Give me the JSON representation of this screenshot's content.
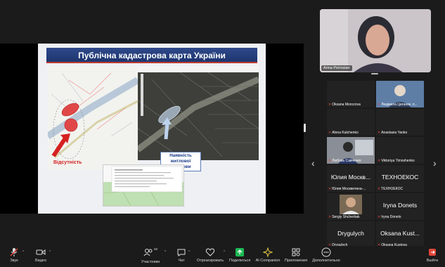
{
  "slide": {
    "title": "Публічна кадастрова карта України",
    "label_housing": "Наявність житлової забудови",
    "label_absent": "Відсутність"
  },
  "speaker": {
    "name": "Arina Petrosian"
  },
  "participants": [
    {
      "id": "p1",
      "name": "Oksana Morozova",
      "display": ""
    },
    {
      "id": "p2",
      "name": "Людмила Циганок, п...",
      "display": ""
    },
    {
      "id": "p3",
      "name": "Alona Kalchenko",
      "display": ""
    },
    {
      "id": "p4",
      "name": "Anastasia Yanko",
      "display": ""
    },
    {
      "id": "p5",
      "name": "Любовь Савченко",
      "display": ""
    },
    {
      "id": "p6",
      "name": "Viktoriya Timoshenko",
      "display": ""
    },
    {
      "id": "p7",
      "name": "Юлия Москвитина-...",
      "display": "Юлия Москв..."
    },
    {
      "id": "p8",
      "name": "ТЕХНОЕКОС",
      "display": "ТЕХНОЕКОС"
    },
    {
      "id": "p9",
      "name": "Sergiy Shcherbak",
      "display": ""
    },
    {
      "id": "p10",
      "name": "Iryna Donets",
      "display": "Iryna Donets"
    },
    {
      "id": "p11",
      "name": "Drygulych",
      "display": "Drygulych"
    },
    {
      "id": "p12",
      "name": "Oksana Kustova",
      "display": "Oksana Kust..."
    }
  ],
  "toolbar": {
    "audio": "Звук",
    "video": "Видео",
    "participants": "Участники",
    "participants_count": "68",
    "chat": "Чат",
    "reactions": "Отреагировать",
    "share": "Поделиться",
    "ai": "AI Companion",
    "apps": "Приложения",
    "more": "Дополнительно",
    "leave": "Выйти"
  },
  "colors": {
    "accent_green": "#1db954",
    "mic_muted": "#e0453a",
    "slide_title_bg": "#1d3670"
  }
}
